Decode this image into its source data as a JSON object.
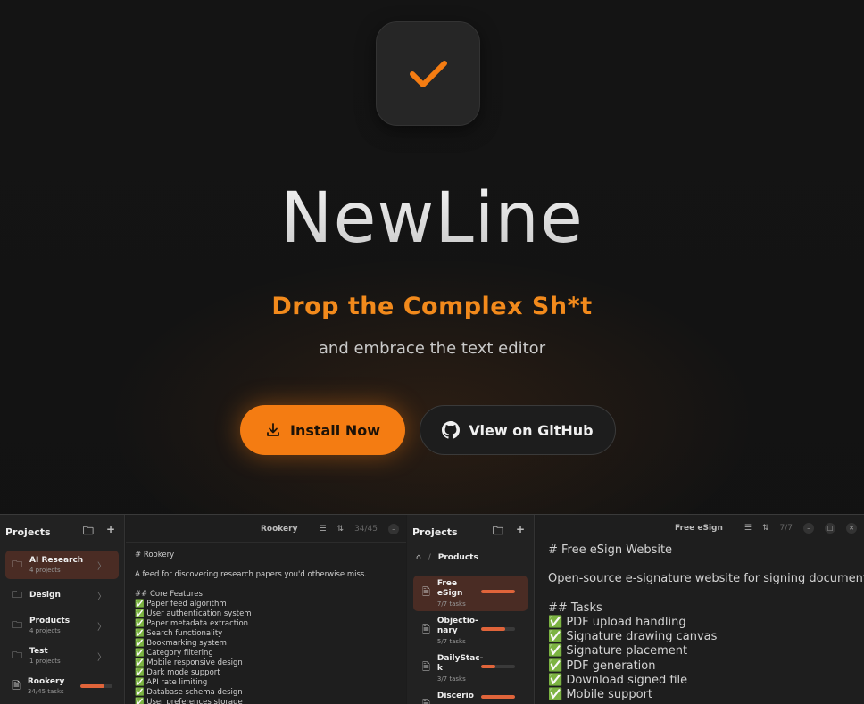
{
  "hero": {
    "title": "NewLine",
    "tagline": "Drop the Complex Sh*t",
    "subtitle": "and embrace the text editor",
    "install_label": "Install Now",
    "github_label": "View on GitHub"
  },
  "colors": {
    "accent": "#f47c12",
    "tagline": "#f28a1c",
    "progress": "#e0643a"
  },
  "preview_left": {
    "sidebar_title": "Projects",
    "projects": [
      {
        "name": "AI Research",
        "sub": "4 projects"
      },
      {
        "name": "Design",
        "sub": ""
      },
      {
        "name": "Products",
        "sub": "4 projects"
      },
      {
        "name": "Test",
        "sub": "1 projects"
      },
      {
        "name": "Rookery",
        "sub": "34/45 tasks",
        "progress": 0.76
      }
    ],
    "editor_title": "Rookery",
    "editor_count": "34/45",
    "editor_lines": [
      "# Rookery",
      "",
      "A feed for discovering research papers you'd otherwise miss.",
      "",
      "## Core Features",
      "✅ Paper feed algorithm",
      "✅ User authentication system",
      "✅ Paper metadata extraction",
      "✅ Search functionality",
      "✅ Bookmarking system",
      "✅ Category filtering",
      "✅ Mobile responsive design",
      "✅ Dark mode support",
      "✅ API rate limiting",
      "✅ Database schema design",
      "✅ User preferences storage"
    ]
  },
  "preview_right": {
    "sidebar_title": "Projects",
    "breadcrumb": "Products",
    "products": [
      {
        "name": "Free eSign",
        "sub": "7/7 tasks",
        "progress": 1.0
      },
      {
        "name": "Objectio-nary",
        "sub": "5/7 tasks",
        "progress": 0.71
      },
      {
        "name": "DailyStac-k",
        "sub": "3/7 tasks",
        "progress": 0.43
      },
      {
        "name": "Discerio",
        "sub": "",
        "progress": 1.0
      }
    ],
    "editor_title": "Free eSign",
    "editor_count": "7/7",
    "editor_lines": [
      "# Free eSign Website",
      "",
      "Open-source e-signature website for signing documents",
      "",
      "## Tasks",
      "✅ PDF upload handling",
      "✅ Signature drawing canvas",
      "✅ Signature placement",
      "✅ PDF generation",
      "✅ Download signed file",
      "✅ Mobile support"
    ]
  }
}
